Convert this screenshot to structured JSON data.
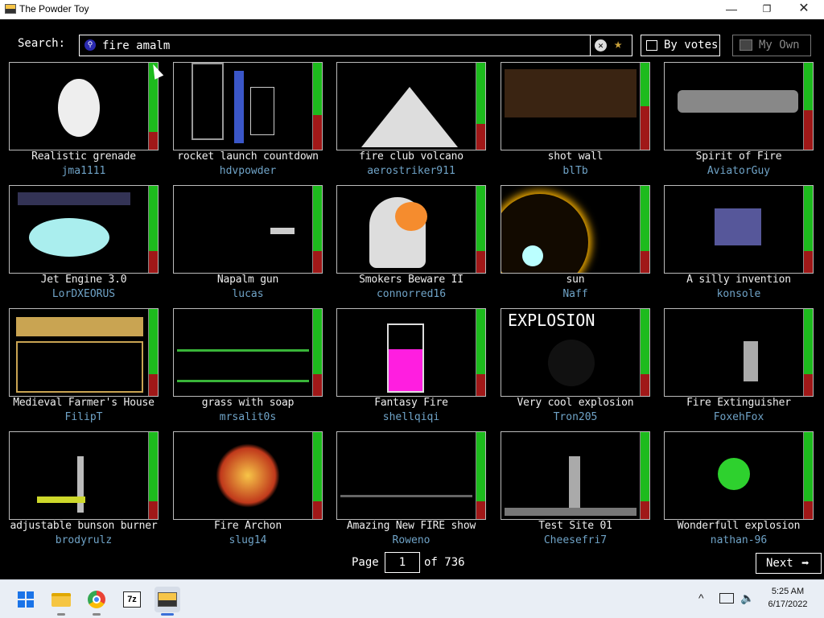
{
  "window": {
    "title": "The Powder Toy",
    "min": "—",
    "max": "❐",
    "close": "✕"
  },
  "search": {
    "label": "Search:",
    "value": "fire amalm",
    "clear": "✕",
    "fav": "★"
  },
  "sort_button": {
    "label": "By votes",
    "icon": "sort-icon"
  },
  "my_own_button": {
    "label": "My Own",
    "icon": "folder-icon"
  },
  "saves": [
    {
      "name": "Realistic grenade",
      "author": "jma1111",
      "upvote": 0.8
    },
    {
      "name": "rocket launch countdown",
      "author": "hdvpowder",
      "upvote": 0.6
    },
    {
      "name": "fire club volcano",
      "author": "aerostriker911",
      "upvote": 0.7
    },
    {
      "name": "shot wall",
      "author": "blTb",
      "upvote": 0.5
    },
    {
      "name": "Spirit of Fire",
      "author": "AviatorGuy",
      "upvote": 0.55
    },
    {
      "name": "Jet Engine 3.0",
      "author": "LorDXEORUS",
      "upvote": 0.75
    },
    {
      "name": "Napalm gun",
      "author": "lucas",
      "upvote": 0.75
    },
    {
      "name": "Smokers Beware II",
      "author": "connorred16",
      "upvote": 0.75
    },
    {
      "name": "sun",
      "author": "Naff",
      "upvote": 0.75
    },
    {
      "name": "A silly invention",
      "author": "konsole",
      "upvote": 0.75
    },
    {
      "name": "Medieval Farmer's House",
      "author": "FilipT",
      "upvote": 0.75
    },
    {
      "name": "grass with soap",
      "author": "mrsalit0s",
      "upvote": 0.75
    },
    {
      "name": "Fantasy Fire",
      "author": "shellqiqi",
      "upvote": 0.75
    },
    {
      "name": "Very cool explosion",
      "author": "Tron205",
      "upvote": 0.75
    },
    {
      "name": "Fire Extinguisher",
      "author": "FoxehFox",
      "upvote": 0.75
    },
    {
      "name": "adjustable bunson burner",
      "author": "brodyrulz",
      "upvote": 0.8
    },
    {
      "name": "Fire Archon",
      "author": "slug14",
      "upvote": 0.8
    },
    {
      "name": "Amazing New FIRE show",
      "author": "Roweno",
      "upvote": 0.8
    },
    {
      "name": "Test Site 01",
      "author": "Cheesefri7",
      "upvote": 0.8
    },
    {
      "name": "Wonderfull explosion",
      "author": "nathan-96",
      "upvote": 0.8
    }
  ],
  "thumb_text": {
    "explosion": "EXPLOSION"
  },
  "pager": {
    "page_label": "Page",
    "current": "1",
    "of_label": "of 736",
    "next": "Next",
    "next_arrow": "➡"
  },
  "taskbar": {
    "apps": [
      "start-icon",
      "file-explorer-icon",
      "chrome-icon",
      "7zip-icon",
      "powder-toy-icon"
    ],
    "sevenz_text": "7z",
    "tray_chevron": "^",
    "time": "5:25 AM",
    "date": "6/17/2022"
  },
  "colors": {
    "upvote": "#1dbb1d",
    "downvote": "#a01818",
    "author": "#6fa3c7",
    "windows_blue": "#1a73e8"
  }
}
